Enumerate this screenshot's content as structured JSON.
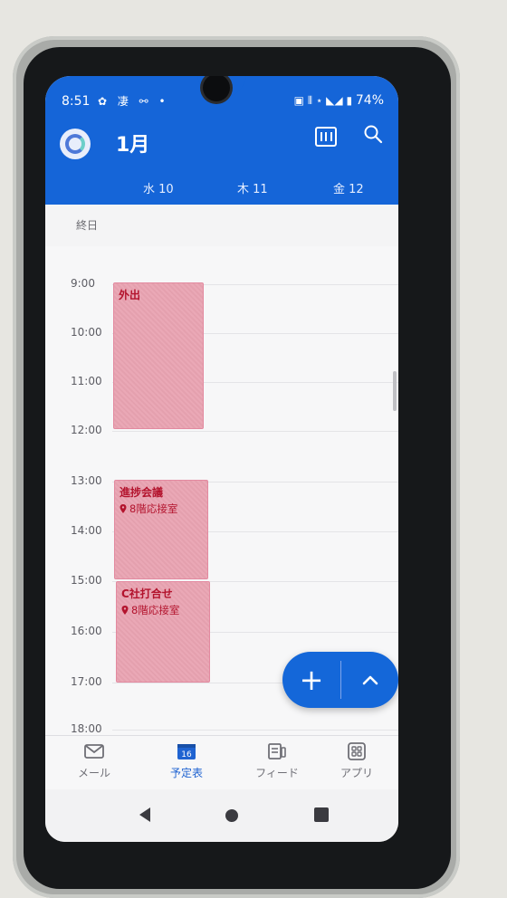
{
  "status_bar": {
    "time": "8:51",
    "left_icons": "✿ 凄 ⚯ •",
    "right_icons": "▣ ⦀ ⋆ ◣◢ ▮",
    "battery": "74%"
  },
  "header": {
    "month": "1月",
    "days": [
      "水 10",
      "木 11",
      "金 12"
    ],
    "colors": {
      "primary": "#1565d8"
    }
  },
  "all_day_label": "終日",
  "hours": [
    "9:00",
    "10:00",
    "11:00",
    "12:00",
    "13:00",
    "14:00",
    "15:00",
    "16:00",
    "17:00",
    "18:00"
  ],
  "events": [
    {
      "title": "外出",
      "location": ""
    },
    {
      "title": "進捗会議",
      "location": "8階応接室"
    },
    {
      "title": "C社打合せ",
      "location": "8階応接室"
    }
  ],
  "bottom_nav": {
    "items": [
      {
        "label": "メール",
        "icon": "mail-icon"
      },
      {
        "label": "予定表",
        "icon": "calendar-icon",
        "badge": "16",
        "active": true
      },
      {
        "label": "フィード",
        "icon": "feed-icon"
      },
      {
        "label": "アプリ",
        "icon": "apps-icon"
      }
    ]
  },
  "fab": {
    "add_symbol": "+"
  }
}
